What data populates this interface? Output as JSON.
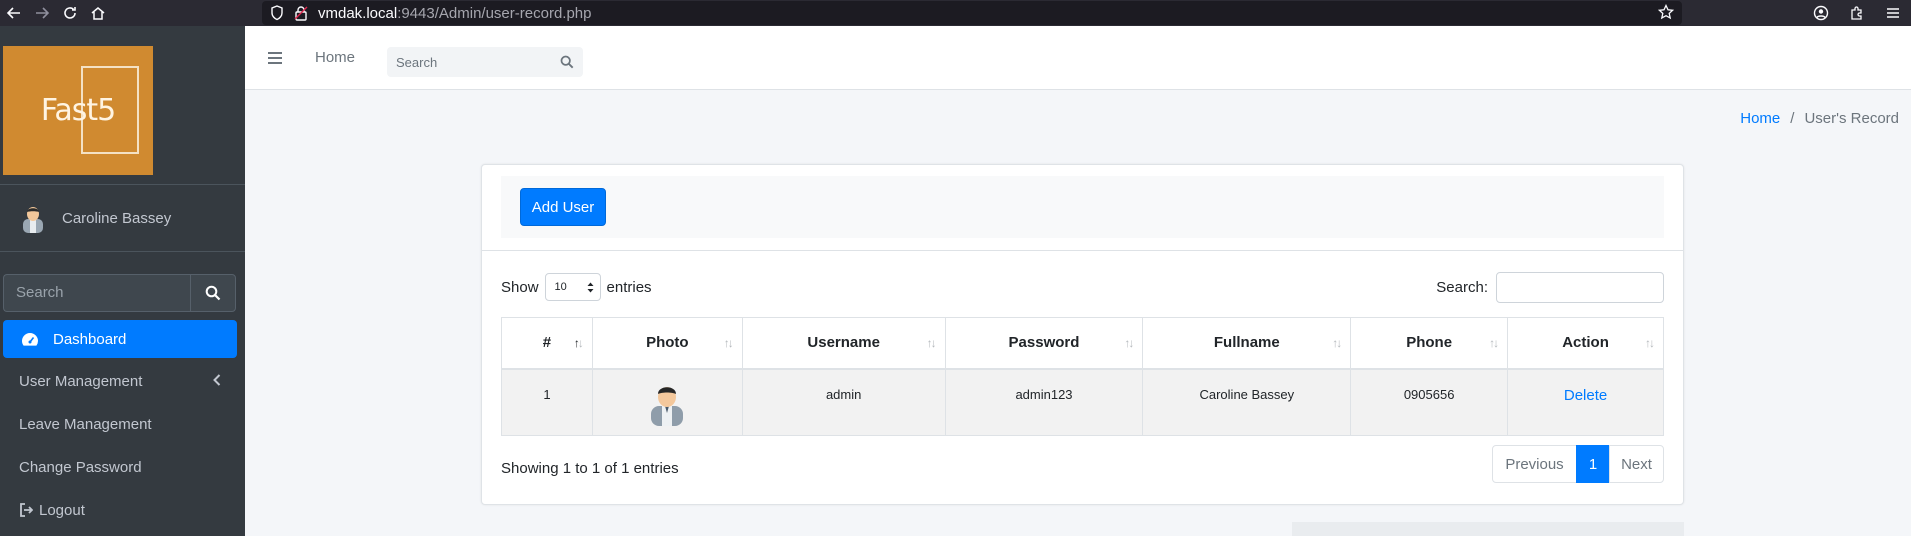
{
  "browser": {
    "url_host": "vmdak.local",
    "url_rest": ":9443/Admin/user-record.php"
  },
  "sidebar": {
    "brand": "Fast5",
    "user_name": "Caroline Bassey",
    "search_placeholder": "Search",
    "items": [
      {
        "label": "Dashboard",
        "active": true
      },
      {
        "label": "User Management"
      },
      {
        "label": "Leave Management"
      },
      {
        "label": "Change Password"
      },
      {
        "label": "Logout"
      }
    ]
  },
  "topnav": {
    "home": "Home",
    "search_placeholder": "Search"
  },
  "breadcrumb": {
    "home": "Home",
    "current": "User's Record"
  },
  "card": {
    "add_button": "Add User",
    "show_label": "Show",
    "entries_value": "10",
    "entries_label": "entries",
    "search_label": "Search:",
    "columns": [
      "#",
      "Photo",
      "Username",
      "Password",
      "Fullname",
      "Phone",
      "Action"
    ],
    "rows": [
      {
        "num": "1",
        "username": "admin",
        "password": "admin123",
        "fullname": "Caroline Bassey",
        "phone": "0905656",
        "action": "Delete"
      }
    ],
    "info": "Showing 1 to 1 of 1 entries",
    "pagination": {
      "previous": "Previous",
      "current": "1",
      "next": "Next"
    }
  },
  "colors": {
    "accent": "#007bff",
    "sidebar_bg": "#343a40",
    "brand_bg": "#d08a30"
  }
}
